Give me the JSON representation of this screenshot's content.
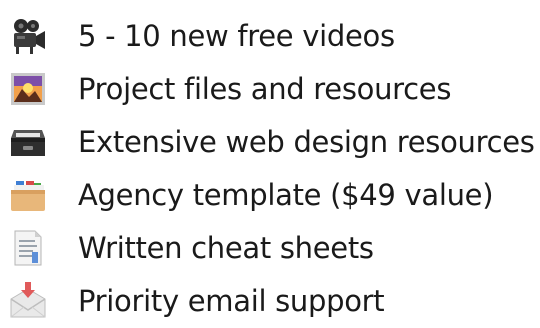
{
  "features": [
    {
      "label": "5 - 10 new free videos",
      "icon": "movie-camera-icon"
    },
    {
      "label": "Project files and resources",
      "icon": "landscape-picture-icon"
    },
    {
      "label": "Extensive web design resources",
      "icon": "card-file-box-icon"
    },
    {
      "label": "Agency template ($49 value)",
      "icon": "card-index-dividers-icon"
    },
    {
      "label": "Written cheat sheets",
      "icon": "page-with-curl-icon"
    },
    {
      "label": "Priority email support",
      "icon": "envelope-with-arrow-icon"
    }
  ]
}
